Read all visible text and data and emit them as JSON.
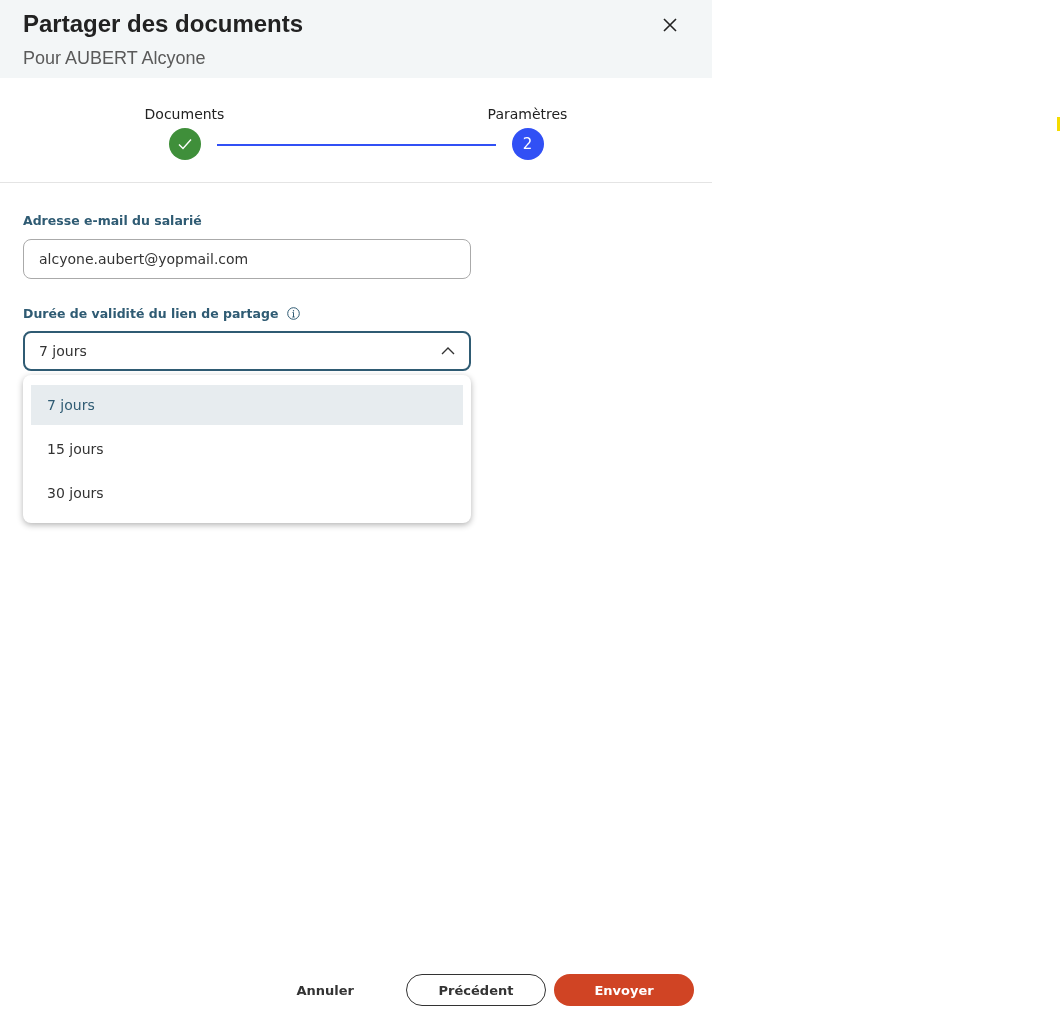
{
  "dialog": {
    "title": "Partager des documents",
    "subtitle": "Pour AUBERT Alcyone"
  },
  "steps": [
    {
      "label": "Documents",
      "completed": true,
      "selected": false
    },
    {
      "label": "Paramètres",
      "completed": false,
      "selected": true,
      "number": "2"
    }
  ],
  "email_field": {
    "label": "Adresse e-mail du salarié",
    "value": "alcyone.aubert@yopmail.com"
  },
  "duration_select": {
    "label": "Durée de validité du lien de partage",
    "value": "7 jours",
    "expanded": true,
    "options": [
      {
        "label": "7 jours",
        "selected": true
      },
      {
        "label": "15 jours",
        "selected": false
      },
      {
        "label": "30 jours",
        "selected": false
      }
    ]
  },
  "buttons": [
    {
      "label": "Annuler",
      "kind": "text"
    },
    {
      "label": "Précédent",
      "kind": "outline"
    },
    {
      "label": "Envoyer",
      "kind": "primary"
    }
  ]
}
